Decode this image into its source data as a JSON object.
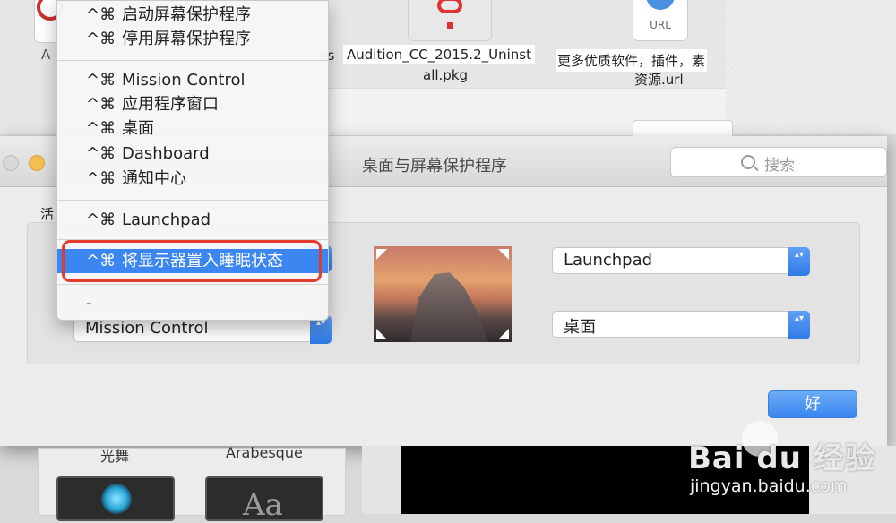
{
  "finder": {
    "file_label_a": "A",
    "file_label_ns": "ns",
    "file_label_audition": "Audition_CC_2015.2_Uninst",
    "file_label_pkg": "all.pkg",
    "file_label_more": "更多优质软件，插件，素",
    "file_label_url": "资源.url",
    "url_icon_text": "URL"
  },
  "window": {
    "title": "桌面与屏幕保护程序",
    "search_placeholder": "搜索",
    "tab_label": "活",
    "ok_label": "好"
  },
  "corners": {
    "bottom_left": "Mission Control",
    "top_right": "Launchpad",
    "bottom_right": "桌面",
    "stepper_glyph": "▴▾"
  },
  "menu": {
    "modifier": "^⌘",
    "items": [
      {
        "label": "启动屏幕保护程序"
      },
      {
        "label": "停用屏幕保护程序"
      },
      {
        "label": "Mission Control"
      },
      {
        "label": "应用程序窗口"
      },
      {
        "label": "桌面"
      },
      {
        "label": "Dashboard"
      },
      {
        "label": "通知中心"
      },
      {
        "label": "Launchpad"
      },
      {
        "label": "将显示器置入睡眠状态"
      },
      {
        "label": "-"
      }
    ]
  },
  "savers": {
    "guangwu": "光舞",
    "arabesque": "Arabesque",
    "arabesque_glyph": "Aa"
  },
  "watermark": {
    "logo": "Bai du 经验",
    "url": "jingyan.baidu.com"
  },
  "colors": {
    "accent": "#3b86f0",
    "highlight_outline": "#e23b2e"
  }
}
